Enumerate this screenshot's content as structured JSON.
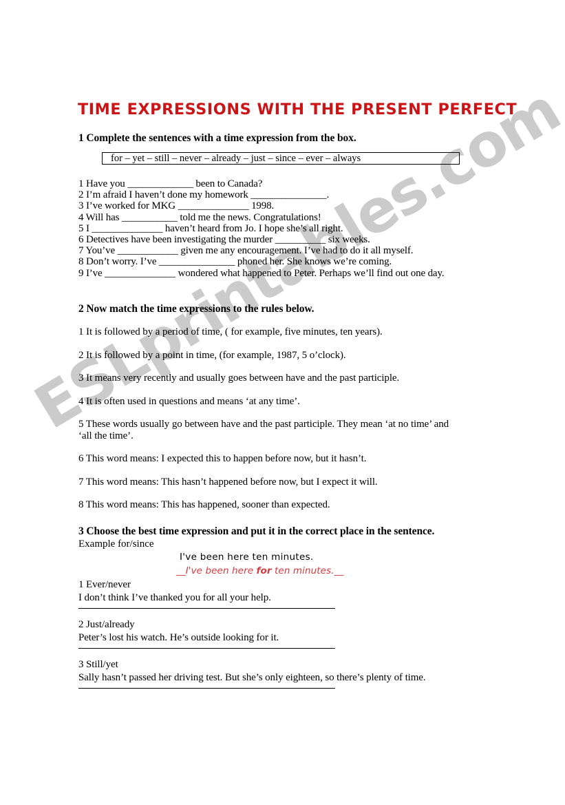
{
  "document": {
    "title": "TIME EXPRESSIONS WITH THE PRESENT PERFECT",
    "title_color": "#cc1417",
    "watermark": "ESLprintables.com"
  },
  "task1": {
    "heading": "1 Complete the sentences with a time expression from the box.",
    "wordbox": "for – yet – still – never – already – just – since – ever – always",
    "sentences": [
      "1 Have you _____________ been to Canada?",
      "2 I’m afraid I haven’t done my homework _______________.",
      "3 I’ve worked for MKG ______________ 1998.",
      "4 Will has ___________ told me the news. Congratulations!",
      "5 I ______________ haven’t heard from Jo. I hope she’s all right.",
      "6 Detectives have been investigating the murder __________ six weeks.",
      "7 You’ve ____________ given me any encouragement. I’ve had to do it all myself.",
      "8 Don’t worry. I’ve _______________ phoned her. She knows we’re coming.",
      "9 I’ve ______________ wondered what happened to Peter. Perhaps we’ll find out one day."
    ]
  },
  "task2": {
    "heading": "2 Now match the time expressions to the rules below.",
    "rules": [
      "1 It is followed by a period of time, ( for example, five minutes, ten years).",
      "2 It is followed by a point in time, (for example, 1987, 5 o’clock).",
      "3 It means very recently and usually goes between have and the past participle.",
      "4 It is often used in questions and means ‘at any time’.",
      "5 These words usually go between have and the past participle. They mean ‘at no time’ and ‘all the time’.",
      "6 This word means: I expected this to happen before now, but it hasn’t.",
      "7 This word means: This hasn’t happened before now, but I expect it will.",
      "8 This word means: This has happened, sooner than expected."
    ]
  },
  "task3": {
    "heading": "3 Choose the best time expression and put it in the correct place in the sentence.",
    "example_label": "Example for/since",
    "example_prompt": "I've been here ten minutes.",
    "example_answer_prefix": "__I've been here ",
    "example_answer_bold": "for",
    "example_answer_suffix": "  ten minutes.__",
    "items": [
      {
        "options": "1 Ever/never",
        "sentence": "I don’t think I’ve thanked you for all your help."
      },
      {
        "options": "2 Just/already",
        "sentence": "Peter’s lost his watch. He’s outside looking for it."
      },
      {
        "options": "3 Still/yet",
        "sentence": "Sally hasn’t passed her driving test. But she’s only eighteen, so there’s plenty of time."
      }
    ]
  }
}
